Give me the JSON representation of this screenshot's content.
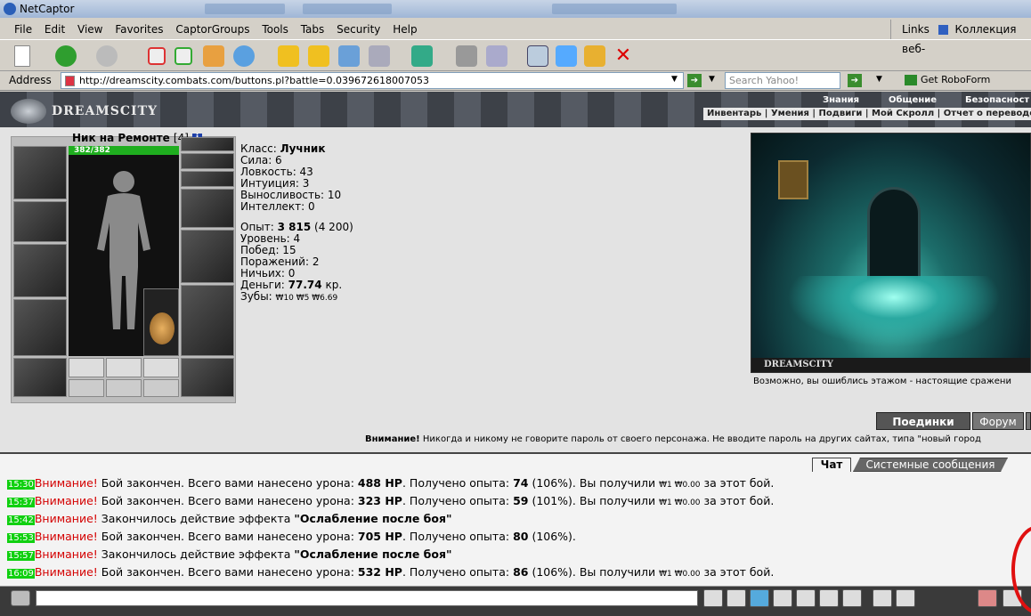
{
  "window": {
    "title": "NetCaptor"
  },
  "menu": [
    "File",
    "Edit",
    "View",
    "Favorites",
    "CaptorGroups",
    "Tools",
    "Tabs",
    "Security",
    "Help"
  ],
  "links": {
    "label": "Links",
    "item": "Коллекция веб-"
  },
  "address": {
    "label": "Address",
    "url": "http://dreamscity.combats.com/buttons.pl?battle=0.039672618007053",
    "search_placeholder": "Search Yahoo!",
    "roboform": "Get RoboForm"
  },
  "site": {
    "logo": "DREAMSCITY",
    "nav_top": [
      "Знания",
      "Общение",
      "Безопасност"
    ],
    "nav_bottom": "Инвентарь | Умения | Подвиги | Мой Скролл | Отчет о переводе"
  },
  "character": {
    "name": "Ник на Ремонте",
    "level": "[4]",
    "hp": "382/382",
    "stats": {
      "class_label": "Класс:",
      "class_value": "Лучник",
      "strength": "Сила: 6",
      "agility": "Ловкость: 43",
      "intuition": "Интуиция: 3",
      "endurance": "Выносливость: 10",
      "intellect": "Интеллект: 0",
      "exp_label": "Опыт:",
      "exp_value": "3 815",
      "exp_next": "(4 200)",
      "level": "Уровень: 4",
      "wins": "Побед: 15",
      "losses": "Поражений: 2",
      "draws": "Ничьих: 0",
      "money_label": "Деньги:",
      "money_value": "77.74",
      "money_unit": "кр.",
      "teeth_label": "Зубы:",
      "teeth_value": "₩10 ₩5 ₩6.69"
    }
  },
  "scene": {
    "caption": "DREAMSCITY",
    "wrong_floor": "Возможно, вы ошиблись этажом - настоящие сражени"
  },
  "buttons": {
    "duels": "Поединки",
    "forum": "Форум"
  },
  "warning": {
    "strong": "Внимание!",
    "text": " Никогда и никому не говорите пароль от своего персонажа. Не вводите пароль на других сайтах, типа \"новый город"
  },
  "chat": {
    "tab_chat": "Чат",
    "tab_system": "Системные сообщения",
    "messages": [
      {
        "time": "15:30",
        "alert": "Внимание!",
        "p1": " Бой закончен. Всего вами нанесено урона: ",
        "b1": "488 HP",
        "p2": ". Получено опыта: ",
        "b2": "74",
        "p3": " (106%). Вы получили ",
        "small": "₩1 ₩0.00",
        "p4": " за этот бой."
      },
      {
        "time": "15:37",
        "alert": "Внимание!",
        "p1": " Бой закончен. Всего вами нанесено урона: ",
        "b1": "323 HP",
        "p2": ". Получено опыта: ",
        "b2": "59",
        "p3": " (101%). Вы получили ",
        "small": "₩1 ₩0.00",
        "p4": " за этот бой."
      },
      {
        "time": "15:42",
        "alert": "Внимание!",
        "p1": " Закончилось действие эффекта ",
        "b1": "\"Ослабление после боя\"",
        "p2": "",
        "b2": "",
        "p3": "",
        "small": "",
        "p4": ""
      },
      {
        "time": "15:53",
        "alert": "Внимание!",
        "p1": " Бой закончен. Всего вами нанесено урона: ",
        "b1": "705 HP",
        "p2": ". Получено опыта: ",
        "b2": "80",
        "p3": " (106%).",
        "small": "",
        "p4": ""
      },
      {
        "time": "15:57",
        "alert": "Внимание!",
        "p1": " Закончилось действие эффекта ",
        "b1": "\"Ослабление после боя\"",
        "p2": "",
        "b2": "",
        "p3": "",
        "small": "",
        "p4": ""
      },
      {
        "time": "16:09",
        "alert": "Внимание!",
        "p1": " Бой закончен. Всего вами нанесено урона: ",
        "b1": "532 HP",
        "p2": ". Получено опыта: ",
        "b2": "86",
        "p3": " (106%). Вы получили ",
        "small": "₩1 ₩0.00",
        "p4": " за этот бой."
      }
    ]
  },
  "colors": {
    "time_bg": "#10d010",
    "alert": "#d40000",
    "hp_bar": "#1fae1f",
    "annotation": "#e01010"
  }
}
